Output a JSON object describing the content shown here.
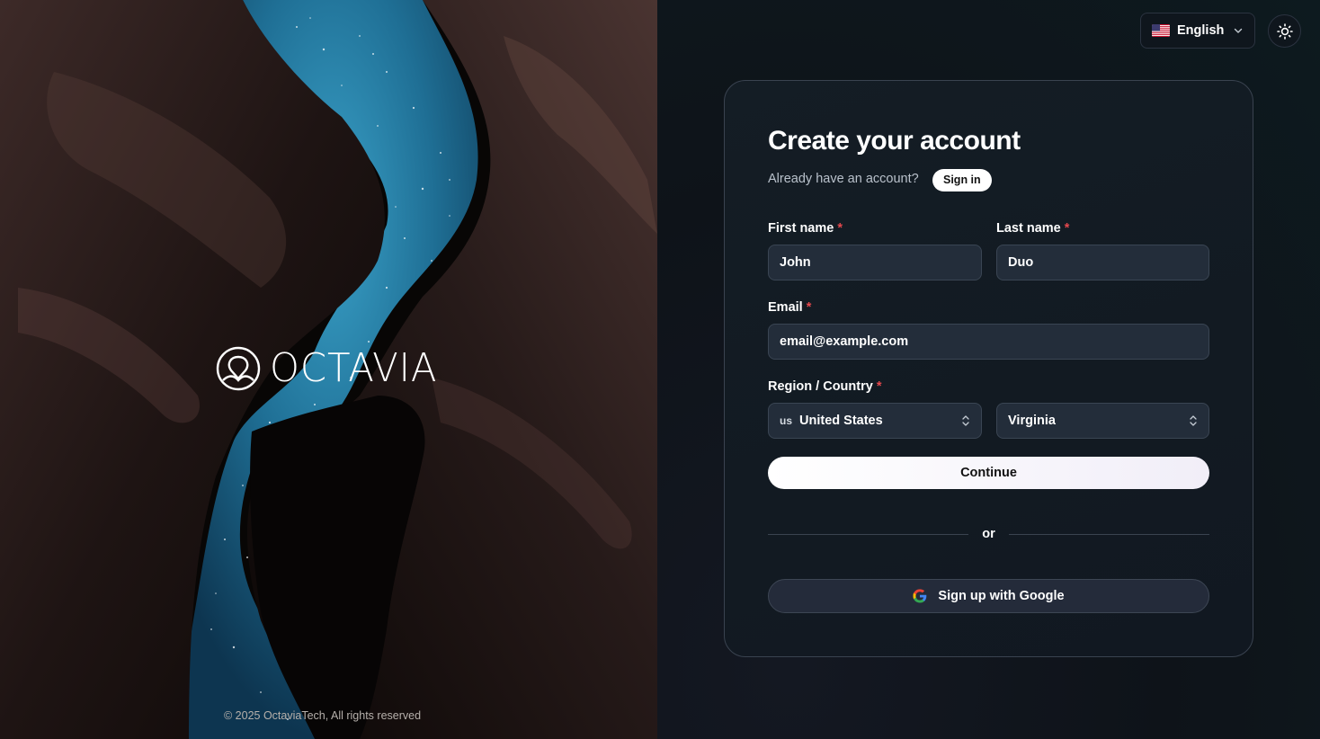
{
  "brand": {
    "name": "OCTAVIA",
    "copyright": "© 2025 OctaviaTech, All rights reserved"
  },
  "header": {
    "language": "English",
    "language_flag": "us-flag-icon",
    "theme_icon": "sun-icon"
  },
  "form": {
    "title": "Create your account",
    "already_text": "Already have an account?",
    "signin_label": "Sign in",
    "first_name": {
      "label": "First name",
      "required": "*",
      "value": "John"
    },
    "last_name": {
      "label": "Last name",
      "required": "*",
      "value": "Duo"
    },
    "email": {
      "label": "Email",
      "required": "*",
      "value": "email@example.com"
    },
    "region": {
      "label": "Region / Country",
      "required": "*",
      "country_code": "us",
      "country": "United States",
      "state": "Virginia"
    },
    "continue_label": "Continue",
    "or_text": "or",
    "google_label": "Sign up with Google"
  },
  "colors": {
    "accent_required": "#e5484d",
    "card_border": "#3a4350",
    "input_bg": "#232d3a",
    "primary_button": "#ffffff"
  }
}
